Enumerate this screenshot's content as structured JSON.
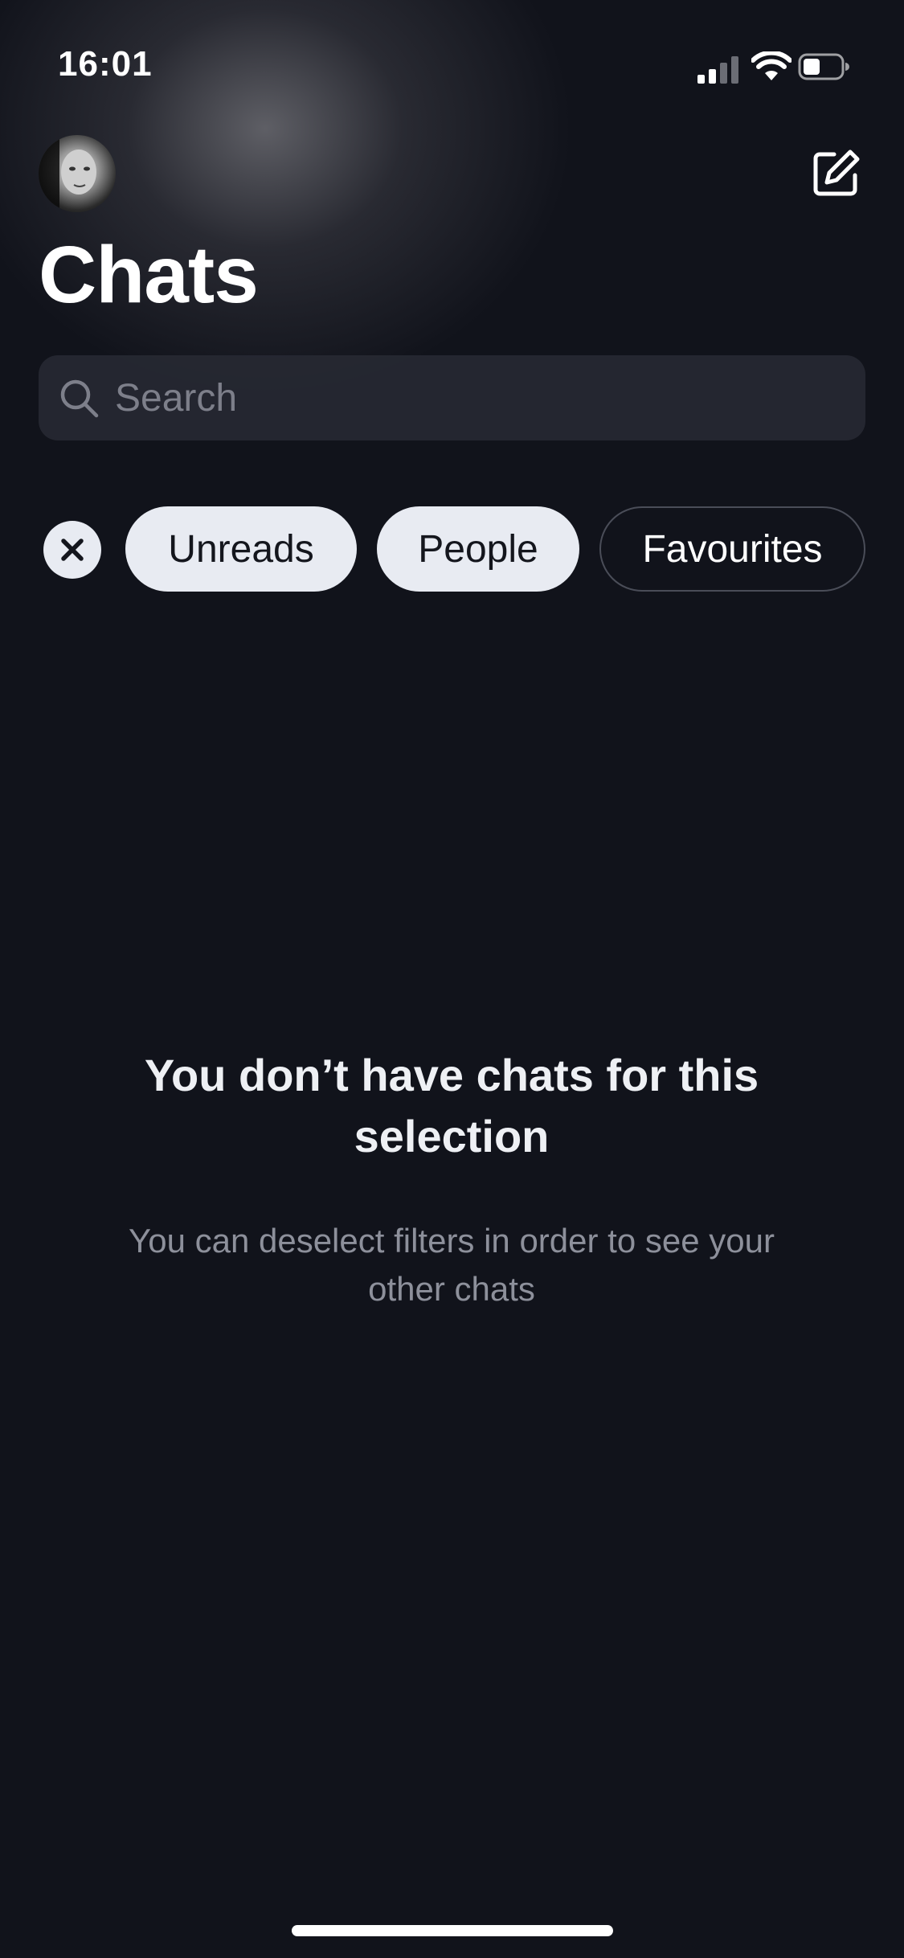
{
  "status_bar": {
    "time": "16:01",
    "icons": [
      "signal-icon",
      "wifi-icon",
      "battery-icon"
    ]
  },
  "header": {
    "title": "Chats",
    "avatar_icon": "avatar",
    "compose_icon": "compose-icon"
  },
  "search": {
    "placeholder": "Search",
    "value": ""
  },
  "filters": {
    "clear_icon": "close-icon",
    "chips": [
      {
        "label": "Unreads",
        "selected": true
      },
      {
        "label": "People",
        "selected": true
      },
      {
        "label": "Favourites",
        "selected": false
      }
    ]
  },
  "empty_state": {
    "title": "You don’t have chats for this selection",
    "subtitle": "You can deselect filters in order to see your other chats"
  },
  "colors": {
    "background": "#11131b",
    "chip_selected": "#e8ebf2",
    "secondary_text": "#8d909b"
  }
}
